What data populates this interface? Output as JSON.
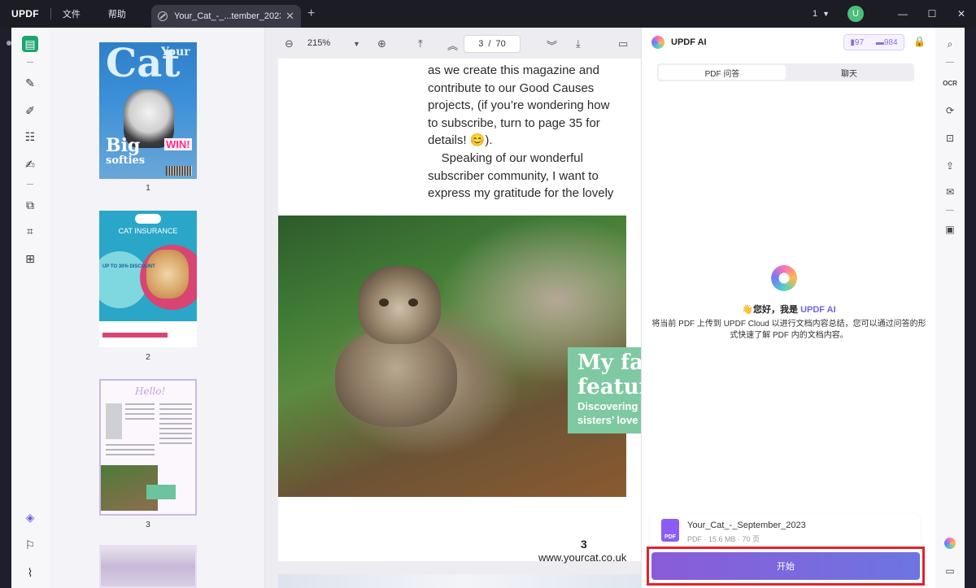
{
  "titlebar": {
    "logo": "UPDF",
    "menu": [
      "文件",
      "帮助"
    ],
    "tab_title": "Your_Cat_-_...tember_2023",
    "window_count": "1",
    "avatar_letter": "U"
  },
  "viewer": {
    "zoom": "215%",
    "page_current": "3",
    "page_sep": "/",
    "page_total": "70",
    "page_text": [
      "as we create this magazine and",
      "contribute to our Good Causes",
      "projects, (if you’re wondering how",
      "to subscribe, turn to page 35 for",
      "details! 😊).",
      "    Speaking of our wonderful",
      "subscriber community, I want to",
      "express my gratitude for the lovely"
    ],
    "box_title_line1": "My fa",
    "box_title_line2": "featur",
    "box_sub_line1": "Discovering t",
    "box_sub_line2": "sisters’ love o",
    "page_number": "3",
    "page_url": "www.yourcat.co.uk"
  },
  "thumbnails": {
    "pages": [
      {
        "num": "1",
        "title": "Cat",
        "small_title": "Your",
        "big": "Big",
        "softies": "softies",
        "win": "WIN!"
      },
      {
        "num": "2",
        "title": "CAT INSURANCE",
        "promo": "UP TO 30% DISCOUNT"
      },
      {
        "num": "3",
        "title": "Hello!"
      }
    ]
  },
  "ai_panel": {
    "title": "UPDF AI",
    "credits_a": "97",
    "credits_b": "984",
    "tab_pdf": "PDF 问答",
    "tab_chat": "聊天",
    "greeting": "👋您好，我是 ",
    "greeting_brand": "UPDF AI",
    "description": "将当前 PDF 上传到 UPDF Cloud 以进行文档内容总结，您可以通过问答的形式快速了解 PDF 内的文档内容。",
    "file_name": "Your_Cat_-_September_2023",
    "file_meta": "PDF · 15.6 MB · 70 页",
    "pdf_label": "PDF",
    "start_label": "开始"
  },
  "colors": {
    "accent_green": "#1aa66e",
    "ai_purple": "#6d75e2",
    "highlight_red": "#e3222b"
  }
}
